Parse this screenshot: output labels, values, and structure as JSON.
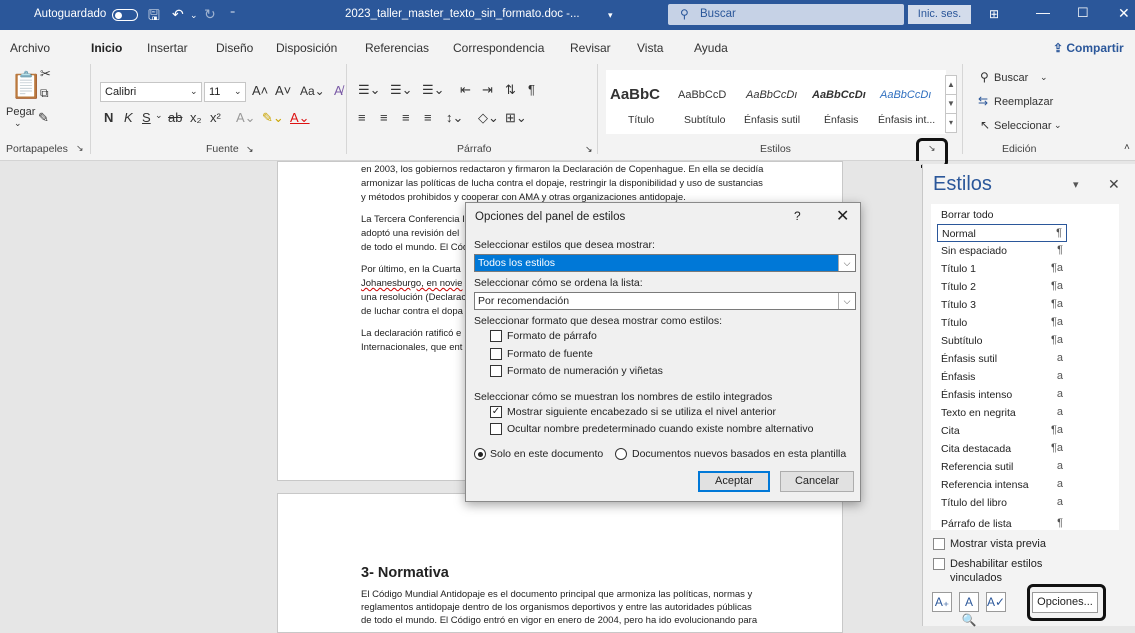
{
  "titlebar": {
    "autosave": "Autoguardado",
    "filename": "2023_taller_master_texto_sin_formato.doc -...",
    "search": "Buscar",
    "signin": "Inic. ses."
  },
  "tabs": [
    "Archivo",
    "Inicio",
    "Insertar",
    "Diseño",
    "Disposición",
    "Referencias",
    "Correspondencia",
    "Revisar",
    "Vista",
    "Ayuda"
  ],
  "share": "Compartir",
  "ribbon": {
    "paste": "Pegar",
    "font_name": "Calibri",
    "font_size": "11",
    "font_btns": [
      "N",
      "K",
      "S",
      "ab",
      "x₂",
      "x²"
    ],
    "styles": [
      {
        "preview": "AaBbC",
        "label": "Título"
      },
      {
        "preview": "AaBbCcD",
        "label": "Subtítulo"
      },
      {
        "preview": "AaBbCcDı",
        "label": "Énfasis sutil"
      },
      {
        "preview": "AaBbCcDı",
        "label": "Énfasis"
      },
      {
        "preview": "AaBbCcDı",
        "label": "Énfasis int..."
      }
    ],
    "edit_search": "Buscar",
    "edit_replace": "Reemplazar",
    "edit_select": "Seleccionar",
    "groups": [
      "Portapapeles",
      "Fuente",
      "Párrafo",
      "Estilos",
      "Edición"
    ]
  },
  "doc": {
    "page1_lines": [
      "en 2003, los gobiernos redactaron y firmaron la Declaración de Copenhague. En ella se decidía",
      "armonizar las políticas de lucha contra el dopaje, restringir la disponibilidad y uso de sustancias",
      "y métodos prohibidos y cooperar con AMA y otras organizaciones antidopaje."
    ],
    "page1_left": [
      "La Tercera Conferencia I",
      "adoptó una revisión del",
      "de todo el mundo. El Cód",
      "Por último, en la Cuarta",
      "Johanesburgo, en novie",
      "una resolución (Declarac",
      "de luchar contra el dopa",
      "La declaración ratificó e",
      "Internacionales, que ent"
    ],
    "heading": "3- Normativa",
    "page2_lines": [
      "El Código Mundial Antidopaje es el documento principal que armoniza las políticas, normas y",
      "reglamentos antidopaje dentro de los organismos deportivos y entre las autoridades públicas",
      "de todo el mundo. El Código entró en vigor en enero de 2004, pero ha ido evolucionando para"
    ]
  },
  "dialog": {
    "title": "Opciones del panel de estilos",
    "help": "?",
    "close": "✕",
    "label_show": "Seleccionar estilos que desea mostrar:",
    "show_value": "Todos los estilos",
    "label_sort": "Seleccionar cómo se ordena la lista:",
    "sort_value": "Por recomendación",
    "label_format": "Seleccionar formato que desea mostrar como estilos:",
    "cb_paragraph": "Formato de párrafo",
    "cb_font": "Formato de fuente",
    "cb_numbering": "Formato de numeración y viñetas",
    "label_names": "Seleccionar cómo se muestran los nombres de estilo integrados",
    "cb_next_heading": "Mostrar siguiente encabezado si se utiliza el nivel anterior",
    "cb_hide_default": "Ocultar nombre predeterminado cuando existe nombre alternativo",
    "radio_doc": "Solo en este documento",
    "radio_template": "Documentos nuevos basados en esta plantilla",
    "ok": "Aceptar",
    "cancel": "Cancelar"
  },
  "pane": {
    "title": "Estilos",
    "items": [
      {
        "name": "Borrar todo",
        "mark": ""
      },
      {
        "name": "Normal",
        "mark": "¶"
      },
      {
        "name": "Sin espaciado",
        "mark": "¶"
      },
      {
        "name": "Título 1",
        "mark": "¶a"
      },
      {
        "name": "Título 2",
        "mark": "¶a"
      },
      {
        "name": "Título 3",
        "mark": "¶a"
      },
      {
        "name": "Título",
        "mark": "¶a"
      },
      {
        "name": "Subtítulo",
        "mark": "¶a"
      },
      {
        "name": "Énfasis sutil",
        "mark": "a"
      },
      {
        "name": "Énfasis",
        "mark": "a"
      },
      {
        "name": "Énfasis intenso",
        "mark": "a"
      },
      {
        "name": "Texto en negrita",
        "mark": "a"
      },
      {
        "name": "Cita",
        "mark": "¶a"
      },
      {
        "name": "Cita destacada",
        "mark": "¶a"
      },
      {
        "name": "Referencia sutil",
        "mark": "a"
      },
      {
        "name": "Referencia intensa",
        "mark": "a"
      },
      {
        "name": "Título del libro",
        "mark": "a"
      },
      {
        "name": "Párrafo de lista",
        "mark": "¶"
      }
    ],
    "preview": "Mostrar vista previa",
    "disable_linked_1": "Deshabilitar estilos",
    "disable_linked_2": "vinculados",
    "options": "Opciones..."
  }
}
